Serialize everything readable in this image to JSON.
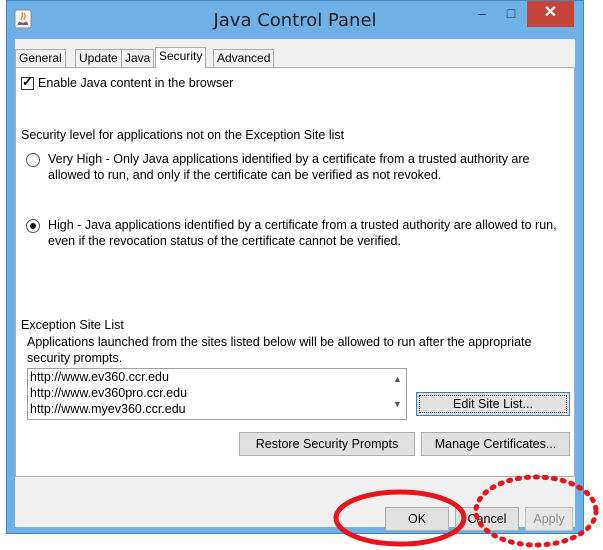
{
  "window": {
    "title": "Java Control Panel",
    "controls": {
      "minimize": "–",
      "maximize": "□",
      "close": "✕"
    },
    "icon": "java-icon"
  },
  "tabs": [
    {
      "label": "General",
      "active": false
    },
    {
      "label": "Update",
      "active": false
    },
    {
      "label": "Java",
      "active": false
    },
    {
      "label": "Security",
      "active": true
    },
    {
      "label": "Advanced",
      "active": false
    }
  ],
  "security": {
    "enable_checkbox": {
      "label": "Enable Java content in the browser",
      "checked": true
    },
    "level_heading": "Security level for applications not on the Exception Site list",
    "options": [
      {
        "label": "Very High - Only Java applications identified by a certificate from a trusted authority are allowed to run, and only if the certificate can be verified as not revoked.",
        "selected": false
      },
      {
        "label": "High - Java applications identified by a certificate from a trusted authority are allowed to run, even if the revocation status of the certificate cannot be verified.",
        "selected": true
      }
    ],
    "exception": {
      "heading": "Exception Site List",
      "description": "Applications launched from the sites listed below will be allowed to run after the appropriate security prompts.",
      "sites": [
        "http://www.ev360.ccr.edu",
        "http://www.ev360pro.ccr.edu",
        "http://www.myev360.ccr.edu"
      ],
      "edit_button": "Edit Site List..."
    },
    "restore_button": "Restore Security Prompts",
    "manage_button": "Manage Certificates..."
  },
  "footer": {
    "ok": "OK",
    "cancel": "Cancel",
    "apply": "Apply"
  },
  "annotations": {
    "ok_highlight_color": "#e8141b",
    "apply_highlight_color": "#e8141b"
  }
}
